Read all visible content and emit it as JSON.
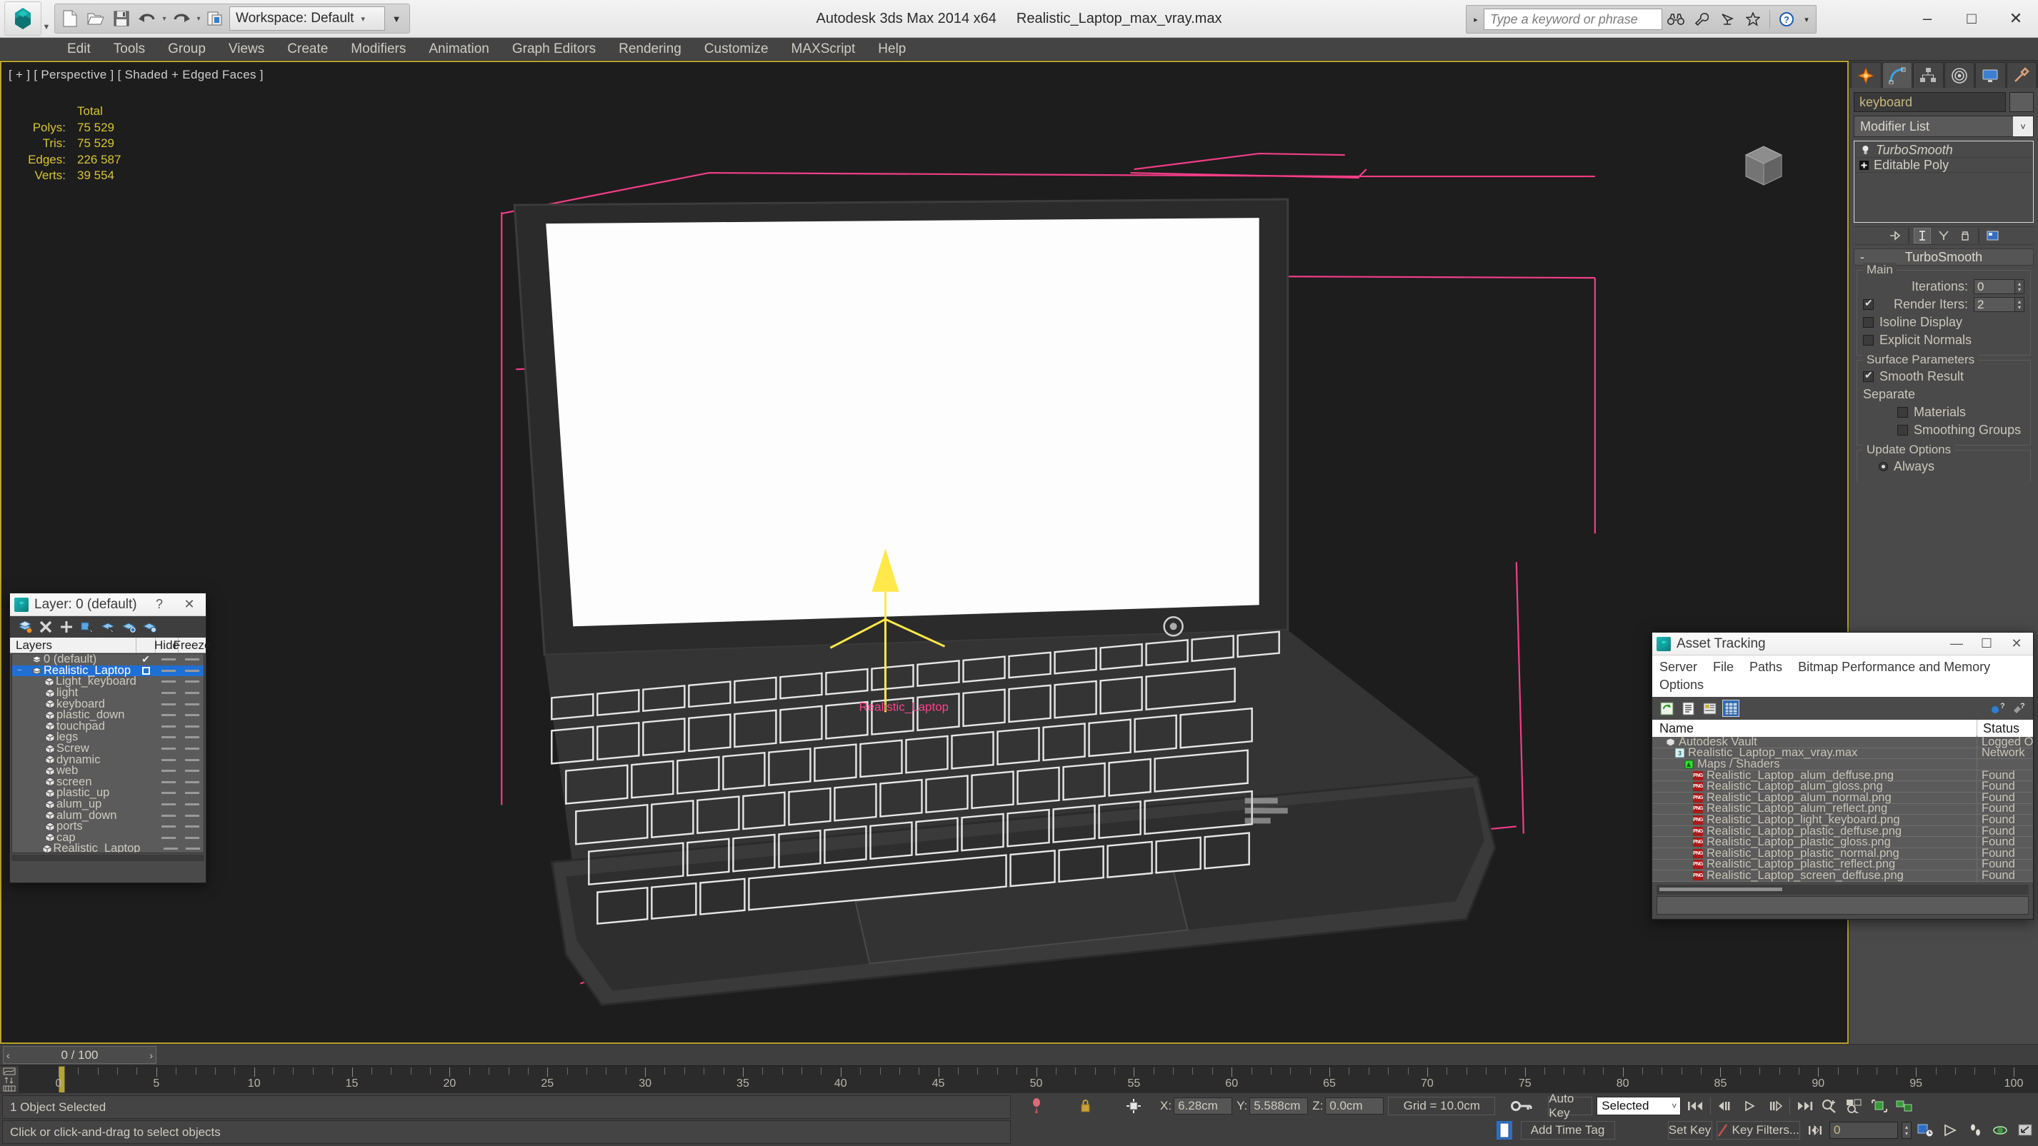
{
  "app": {
    "title_product": "Autodesk 3ds Max  2014 x64",
    "title_file": "Realistic_Laptop_max_vray.max",
    "workspace_label": "Workspace: Default",
    "quick_access": [
      "new-file-icon",
      "open-file-icon",
      "save-file-icon",
      "undo-icon",
      "redo-icon",
      "project-folder-icon"
    ],
    "window_buttons": [
      "minimize",
      "maximize",
      "close"
    ]
  },
  "search": {
    "placeholder": "Type a keyword or phrase",
    "icons": [
      "binoculars-icon",
      "wrench-icon",
      "satellite-dish-icon",
      "star-icon",
      "help-icon"
    ]
  },
  "menubar": {
    "items": [
      "Edit",
      "Tools",
      "Group",
      "Views",
      "Create",
      "Modifiers",
      "Animation",
      "Graph Editors",
      "Rendering",
      "Customize",
      "MAXScript",
      "Help"
    ]
  },
  "viewport": {
    "label": "[ + ] [ Perspective ] [ Shaded + Edged Faces ]",
    "stats_header": "Total",
    "stats": [
      {
        "label": "Polys:",
        "value": "75 529"
      },
      {
        "label": "Tris:",
        "value": "75 529"
      },
      {
        "label": "Edges:",
        "value": "226 587"
      },
      {
        "label": "Verts:",
        "value": "39 554"
      }
    ]
  },
  "command_panel": {
    "tabs": [
      "create-tab",
      "modify-tab",
      "hierarchy-tab",
      "motion-tab",
      "display-tab",
      "utilities-tab"
    ],
    "active_tab": "modify-tab",
    "object_name": "keyboard",
    "modifier_list_label": "Modifier List",
    "stack": [
      {
        "name": "TurboSmooth",
        "italic": true,
        "icon": "light-bulb-icon"
      },
      {
        "name": "Editable Poly",
        "italic": false,
        "icon": "plus-box-icon"
      }
    ],
    "rollout": {
      "title": "TurboSmooth",
      "collapse_glyph": "-",
      "groups": [
        {
          "title": "Main",
          "rows": [
            {
              "type": "spinner",
              "label": "Iterations:",
              "value": "0",
              "checkbox": null
            },
            {
              "type": "spinner",
              "label": "Render Iters:",
              "value": "2",
              "checkbox": true
            },
            {
              "type": "checkbox",
              "label": "Isoline Display",
              "checked": false
            },
            {
              "type": "checkbox",
              "label": "Explicit Normals",
              "checked": false
            }
          ]
        },
        {
          "title": "Surface Parameters",
          "rows": [
            {
              "type": "checkbox",
              "label": "Smooth Result",
              "checked": true
            },
            {
              "type": "text",
              "label": "Separate"
            },
            {
              "type": "checkbox",
              "label": "Materials",
              "checked": false,
              "indent": true
            },
            {
              "type": "checkbox",
              "label": "Smoothing Groups",
              "checked": false,
              "indent": true
            }
          ]
        },
        {
          "title": "Update Options",
          "rows": [
            {
              "type": "radio",
              "label": "Always",
              "checked": true
            }
          ]
        }
      ]
    }
  },
  "layer_dialog": {
    "title": "Layer: 0 (default)",
    "help_glyph": "?",
    "close_glyph": "✕",
    "toolbar_icons": [
      "create-new-layer-icon",
      "delete-layer-icon",
      "add-layer-icon",
      "select-objects-in-layer-icon",
      "select-highlighted-objects-icon",
      "highlight-selected-objects-icon",
      "layer-properties-icon"
    ],
    "columns": [
      "Layers",
      "",
      "Hide",
      "Freeze"
    ],
    "rows": [
      {
        "name": "0 (default)",
        "indent": 0,
        "icon": "layer-icon",
        "expander": "",
        "check": "✔",
        "selected": false
      },
      {
        "name": "Realistic_Laptop",
        "indent": 0,
        "icon": "layer-icon",
        "expander": "−",
        "check": "box",
        "selected": true
      },
      {
        "name": "Light_keyboard",
        "indent": 1,
        "icon": "object-icon",
        "expander": "",
        "check": "",
        "selected": false
      },
      {
        "name": "light",
        "indent": 1,
        "icon": "object-icon",
        "expander": "",
        "check": "",
        "selected": false
      },
      {
        "name": "keyboard",
        "indent": 1,
        "icon": "object-icon",
        "expander": "",
        "check": "",
        "selected": false
      },
      {
        "name": "plastic_down",
        "indent": 1,
        "icon": "object-icon",
        "expander": "",
        "check": "",
        "selected": false
      },
      {
        "name": "touchpad",
        "indent": 1,
        "icon": "object-icon",
        "expander": "",
        "check": "",
        "selected": false
      },
      {
        "name": "legs",
        "indent": 1,
        "icon": "object-icon",
        "expander": "",
        "check": "",
        "selected": false
      },
      {
        "name": "Screw",
        "indent": 1,
        "icon": "object-icon",
        "expander": "",
        "check": "",
        "selected": false
      },
      {
        "name": "dynamic",
        "indent": 1,
        "icon": "object-icon",
        "expander": "",
        "check": "",
        "selected": false
      },
      {
        "name": "web",
        "indent": 1,
        "icon": "object-icon",
        "expander": "",
        "check": "",
        "selected": false
      },
      {
        "name": "screen",
        "indent": 1,
        "icon": "object-icon",
        "expander": "",
        "check": "",
        "selected": false
      },
      {
        "name": "plastic_up",
        "indent": 1,
        "icon": "object-icon",
        "expander": "",
        "check": "",
        "selected": false
      },
      {
        "name": "alum_up",
        "indent": 1,
        "icon": "object-icon",
        "expander": "",
        "check": "",
        "selected": false
      },
      {
        "name": "alum_down",
        "indent": 1,
        "icon": "object-icon",
        "expander": "",
        "check": "",
        "selected": false
      },
      {
        "name": "ports",
        "indent": 1,
        "icon": "object-icon",
        "expander": "",
        "check": "",
        "selected": false
      },
      {
        "name": "cap",
        "indent": 1,
        "icon": "object-icon",
        "expander": "",
        "check": "",
        "selected": false
      },
      {
        "name": "Realistic_Laptop",
        "indent": 1,
        "icon": "object-icon",
        "expander": "",
        "check": "",
        "selected": false
      }
    ]
  },
  "asset_tracking": {
    "title": "Asset Tracking",
    "window_buttons": [
      "—",
      "☐",
      "✕"
    ],
    "menu": [
      "Server",
      "File",
      "Paths",
      "Bitmap Performance and Memory",
      "Options"
    ],
    "toolbar_icons": [
      "refresh-icon",
      "list-view-icon",
      "detail-view-icon",
      "grid-view-icon"
    ],
    "toolbar_right_icons": [
      "help-asset-icon",
      "help-query-icon"
    ],
    "columns": [
      "Name",
      "Status"
    ],
    "rows": [
      {
        "name": "Autodesk Vault",
        "status": "Logged O",
        "indent": 1,
        "icon": "vault-icon"
      },
      {
        "name": "Realistic_Laptop_max_vray.max",
        "status": "Network",
        "indent": 2,
        "icon": "max-file-icon"
      },
      {
        "name": "Maps / Shaders",
        "status": "",
        "indent": 3,
        "icon": "maps-shaders-icon"
      },
      {
        "name": "Realistic_Laptop_alum_deffuse.png",
        "status": "Found",
        "indent": 4,
        "icon": "png-icon"
      },
      {
        "name": "Realistic_Laptop_alum_gloss.png",
        "status": "Found",
        "indent": 4,
        "icon": "png-icon"
      },
      {
        "name": "Realistic_Laptop_alum_normal.png",
        "status": "Found",
        "indent": 4,
        "icon": "png-icon"
      },
      {
        "name": "Realistic_Laptop_alum_reflect.png",
        "status": "Found",
        "indent": 4,
        "icon": "png-icon"
      },
      {
        "name": "Realistic_Laptop_light_keyboard.png",
        "status": "Found",
        "indent": 4,
        "icon": "png-icon"
      },
      {
        "name": "Realistic_Laptop_plastic_deffuse.png",
        "status": "Found",
        "indent": 4,
        "icon": "png-icon"
      },
      {
        "name": "Realistic_Laptop_plastic_gloss.png",
        "status": "Found",
        "indent": 4,
        "icon": "png-icon"
      },
      {
        "name": "Realistic_Laptop_plastic_normal.png",
        "status": "Found",
        "indent": 4,
        "icon": "png-icon"
      },
      {
        "name": "Realistic_Laptop_plastic_reflect.png",
        "status": "Found",
        "indent": 4,
        "icon": "png-icon"
      },
      {
        "name": "Realistic_Laptop_screen_deffuse.png",
        "status": "Found",
        "indent": 4,
        "icon": "png-icon"
      }
    ]
  },
  "time_slider": {
    "label": "0 / 100",
    "prev_glyph": "‹",
    "next_glyph": "›"
  },
  "track_bar": {
    "ticks": [
      "0",
      "5",
      "10",
      "15",
      "20",
      "25",
      "30",
      "35",
      "40",
      "45",
      "50",
      "55",
      "60",
      "65",
      "70",
      "75",
      "80",
      "85",
      "90",
      "95",
      "100"
    ],
    "range_start": 0,
    "range_end": 100,
    "current_frame": 0
  },
  "status_bar": {
    "selection_text": "1 Object Selected",
    "prompt_text": "Click or click-and-drag to select objects",
    "coords": [
      {
        "axis": "X:",
        "value": "6.28cm"
      },
      {
        "axis": "Y:",
        "value": "5.588cm"
      },
      {
        "axis": "Z:",
        "value": "0.0cm"
      }
    ],
    "grid_text": "Grid = 10.0cm",
    "add_time_tag": "Add Time Tag",
    "auto_key": "Auto Key",
    "set_key": "Set Key",
    "selected_dropdown": "Selected",
    "key_filters": "Key Filters...",
    "frame_value": "0",
    "lock_icon": "lock-selection-icon",
    "pin_icon": "pin-stack-icon",
    "absolute_icon": "absolute-relative-transform-icon",
    "key_icon": "key-mode-icon",
    "nav_icons_top": [
      "go-to-start-icon",
      "previous-frame-icon",
      "play-animation-icon",
      "next-frame-icon",
      "go-to-end-icon",
      "zoom-icon",
      "zoom-region-icon",
      "zoom-extents-icon",
      "zoom-extents-all-icon"
    ],
    "nav_icons_bottom": [
      "key-mode-toggle-icon",
      "time-configuration-icon",
      "pan-view-icon",
      "walk-through-icon",
      "orbit-icon",
      "maximize-viewport-icon"
    ]
  },
  "colors": {
    "accent_blue": "#1f6fd4",
    "viewport_border": "#b9a22c",
    "stats_yellow": "#d7c33a",
    "grid_pink": "#ff3f8e",
    "gizmo_yellow": "#ffe84a",
    "panel_bg": "#4a4a4a",
    "viewport_bg": "#1d1d1d"
  }
}
